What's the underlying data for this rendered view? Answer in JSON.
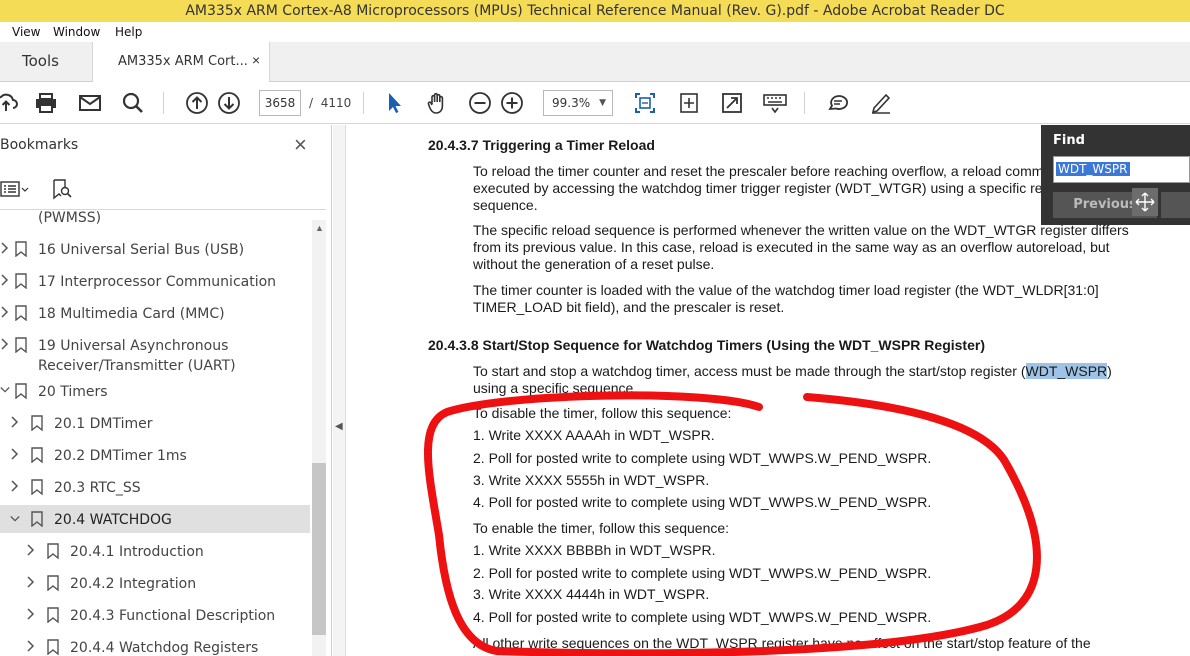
{
  "window": {
    "title": "AM335x ARM Cortex-A8 Microprocessors (MPUs) Technical Reference Manual (Rev. G).pdf - Adobe Acrobat Reader DC"
  },
  "menu": {
    "items": [
      "View",
      "Window",
      "Help"
    ]
  },
  "tabs": {
    "tools": "Tools",
    "document": "AM335x ARM Cort...",
    "close_glyph": "×"
  },
  "toolbar": {
    "current_page": "3658",
    "page_separator": "/",
    "total_pages": "4110",
    "zoom": "99.3%",
    "icons": [
      "upload-icon",
      "print-icon",
      "mail-icon",
      "search-icon",
      "page-up-icon",
      "page-down-icon",
      "select-cursor-icon",
      "hand-icon",
      "zoom-out-icon",
      "zoom-in-icon",
      "fit-page-icon",
      "rotate-icon",
      "fullscreen-icon",
      "keyboard-icon",
      "comment-icon",
      "sign-icon"
    ]
  },
  "sidebar": {
    "title": "Bookmarks",
    "close_glyph": "×",
    "items": [
      {
        "label": "(PWMSS)"
      },
      {
        "label": "16  Universal Serial Bus (USB)"
      },
      {
        "label": "17  Interprocessor Communication"
      },
      {
        "label": "18  Multimedia Card (MMC)"
      },
      {
        "label": "19  Universal Asynchronous",
        "label2": "Receiver/Transmitter (UART)"
      },
      {
        "label": "20  Timers"
      },
      {
        "label": "20.1  DMTimer"
      },
      {
        "label": "20.2  DMTimer 1ms"
      },
      {
        "label": "20.3  RTC_SS"
      },
      {
        "label": "20.4  WATCHDOG"
      },
      {
        "label": "20.4.1  Introduction"
      },
      {
        "label": "20.4.2  Integration"
      },
      {
        "label": "20.4.3  Functional Description"
      },
      {
        "label": "20.4.4  Watchdog Registers"
      }
    ]
  },
  "document": {
    "sec1_heading": "20.4.3.7   Triggering a Timer Reload",
    "sec1_p1": [
      "To reload the timer counter and reset the prescaler before reaching overflow, a reload command can be",
      "executed by accessing the watchdog timer trigger register (WDT_WTGR) using a specific reload",
      "sequence."
    ],
    "sec1_p2": [
      "The specific reload sequence is performed whenever the written value on the WDT_WTGR register differs",
      "from its previous value. In this case, reload is executed in the same way as an overflow autoreload, but",
      "without the generation of a reset pulse."
    ],
    "sec1_p3": [
      "The timer counter is loaded with the value of the watchdog timer load register (the WDT_WLDR[31:0]",
      "TIMER_LOAD bit field), and the prescaler is reset."
    ],
    "sec2_heading": "20.4.3.8   Start/Stop Sequence for Watchdog Timers (Using the WDT_WSPR Register)",
    "sec2_p1_a": "To start and stop a watchdog timer, access must be made through the start/stop register (",
    "sec2_p1_hl": "WDT_WSPR",
    "sec2_p1_b": ")",
    "sec2_p1_line2": "using a specific sequence.",
    "disable_intro": "To disable the timer, follow this sequence:",
    "disable_steps": [
      "1.  Write XXXX AAAAh in WDT_WSPR.",
      "2.  Poll for posted write to complete using WDT_WWPS.W_PEND_WSPR.",
      "3.  Write XXXX 5555h in WDT_WSPR.",
      "4.  Poll for posted write to complete using WDT_WWPS.W_PEND_WSPR."
    ],
    "enable_intro": "To enable the timer, follow this sequence:",
    "enable_steps": [
      "1.  Write XXXX BBBBh in WDT_WSPR.",
      "2.  Poll for posted write to complete using WDT_WWPS.W_PEND_WSPR.",
      "3.  Write XXXX 4444h in WDT_WSPR.",
      "4.  Poll for posted write to complete using WDT_WWPS.W_PEND_WSPR."
    ],
    "footer_line": "All other write sequences on the WDT_WSPR register have no effect on the start/stop feature of the",
    "annotation_color": "#ee1111"
  },
  "find": {
    "title": "Find",
    "query": "WDT_WSPR",
    "previous_label": "Previous"
  }
}
